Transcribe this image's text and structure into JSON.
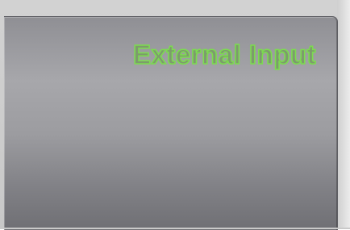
{
  "display": {
    "title": "External Input",
    "title_color": "#7cdc4f"
  }
}
